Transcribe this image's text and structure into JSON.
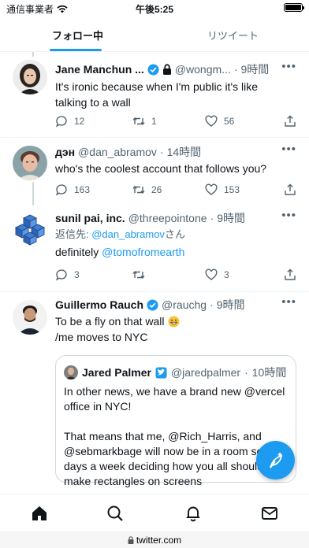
{
  "status_bar": {
    "carrier": "通信事業者",
    "time": "午後5:25",
    "battery_level": 1.0
  },
  "tabs": [
    {
      "label": "フォロー中",
      "active": true
    },
    {
      "label": "リツイート",
      "active": false
    }
  ],
  "tweets": [
    {
      "name": "Jane Manchun ...",
      "handle": "@wongm...",
      "dot": "·",
      "time": "9時間",
      "verified": true,
      "protected": true,
      "text": "It's ironic because when I'm public it's like talking to a wall",
      "replies": "12",
      "retweets": "1",
      "likes": "56"
    },
    {
      "name": "дэн",
      "handle": "@dan_abramov",
      "dot": "·",
      "time": "14時間",
      "text": "who's the coolest account that follows you?",
      "replies": "163",
      "retweets": "26",
      "likes": "153"
    },
    {
      "name": "sunil pai, inc.",
      "handle": "@threepointone",
      "dot": "·",
      "time": "9時間",
      "reply_to_label": "返信先: ",
      "reply_to_handle": "@dan_abramov",
      "reply_to_suffix": "さん",
      "text_prefix": "definitely ",
      "text_mention": "@tomofromearth",
      "replies": "3",
      "retweets": "",
      "likes": "3"
    },
    {
      "name": "Guillermo Rauch",
      "handle": "@rauchg",
      "dot": "·",
      "time": "9時間",
      "verified": true,
      "text_line1": "To be a fly on that wall",
      "text_line2": "/me moves to NYC",
      "quote": {
        "name": "Jared Palmer",
        "handle": "@jaredpalmer",
        "dot": "·",
        "time": "10時間",
        "verified": true,
        "text": "In other news, we have a brand new @vercel office in NYC!\n\nThat means that me, @Rich_Harris, and @sebmarkbage will now be in a room several days a week deciding how you all should make rectangles on screens"
      }
    }
  ],
  "icons": {
    "wifi": "wifi-icon",
    "battery": "battery-icon",
    "verified": "verified-badge-icon",
    "lock": "lock-icon",
    "more": "more-icon",
    "reply": "reply-icon",
    "retweet": "retweet-icon",
    "like": "heart-icon",
    "share": "share-icon",
    "compose": "compose-feather-icon",
    "home": "home-icon",
    "search": "search-icon",
    "notifications": "bell-icon",
    "messages": "mail-icon",
    "url_lock": "lock-icon"
  },
  "url_bar": {
    "url": "twitter.com"
  },
  "colors": {
    "accent": "#1d9bf0",
    "text": "#0f1419",
    "muted": "#536471",
    "border": "#eff3f4"
  }
}
